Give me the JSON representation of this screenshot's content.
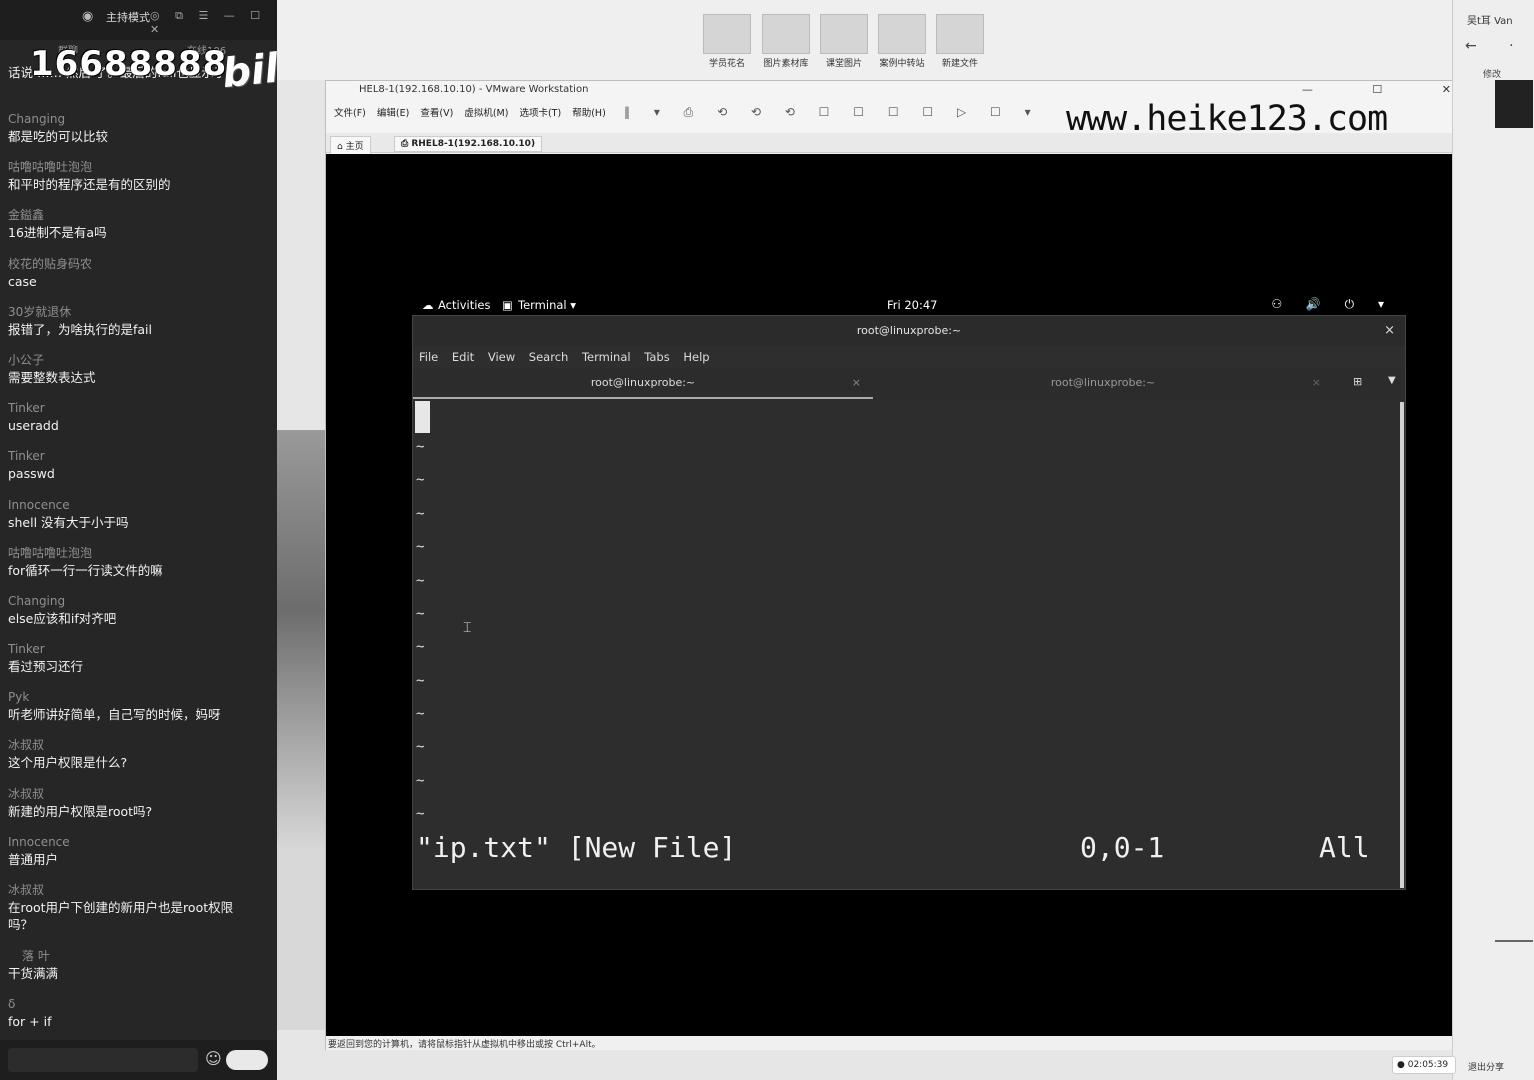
{
  "chat": {
    "mode_label": "主持模式",
    "top_icons": "◎ ⧉ ☰ — ☐ ✕",
    "sub_left": "群聊",
    "sub_right": "在线106",
    "overlay_number": "16688888",
    "overlay_logo": "bilibili",
    "first_message": "话说 …… 然后 了。最后的fail也显示了",
    "messages": [
      {
        "user": "Changing",
        "text": "都是吃的可以比较"
      },
      {
        "user": "咕噜咕噜吐泡泡",
        "text": "和平时的程序还是有的区别的"
      },
      {
        "user": "金鎰鑫",
        "text": "16进制不是有a吗"
      },
      {
        "user": "校花的贴身码农",
        "text": "case"
      },
      {
        "user": "30岁就退休",
        "text": "报错了，为啥执行的是fail"
      },
      {
        "user": "小公子",
        "text": "需要整数表达式"
      },
      {
        "user": "Tinker",
        "text": "useradd"
      },
      {
        "user": "Tinker",
        "text": "passwd"
      },
      {
        "user": "Innocence",
        "text": "shell 没有大于小于吗"
      },
      {
        "user": "咕噜咕噜吐泡泡",
        "text": "for循环一行一行读文件的嘛"
      },
      {
        "user": "Changing",
        "text": "else应该和if对齐吧"
      },
      {
        "user": "Tinker",
        "text": "看过预习还行"
      },
      {
        "user": "Pyk",
        "text": "听老师讲好简单，自己写的时候，妈呀"
      },
      {
        "user": "冰叔叔",
        "text": "这个用户权限是什么?"
      },
      {
        "user": "冰叔叔",
        "text": "新建的用户权限是root吗?"
      },
      {
        "user": "Innocence",
        "text": "普通用户"
      },
      {
        "user": "冰叔叔",
        "text": "在root用户下创建的新用户也是root权限吗？"
      },
      {
        "user": "落 叶",
        "text": "干货满满"
      },
      {
        "user": "δ",
        "text": "for + if"
      }
    ]
  },
  "shelf": [
    "学员花名",
    "图片素材库",
    "课堂图片",
    "案例中转站",
    "新建文件"
  ],
  "vmware": {
    "title": "HEL8-1(192.168.10.10) - VMware Workstation",
    "window_controls": "— ☐ ✕",
    "menu": [
      "文件(F)",
      "编辑(E)",
      "查看(V)",
      "虚拟机(M)",
      "选项卡(T)",
      "帮助(H)"
    ],
    "toolbar_icons": "‖ ▾ ⎙ ⟲ ⟲ ⟲ ☐ ☐ ☐ ☐ ▷ ☐ ▾",
    "watermark": "www.heike123.com",
    "tab_home": "主页",
    "tab_vm": "RHEL8-1(192.168.10.10)",
    "status_text": "要返回到您的计算机，请将鼠标指针从虚拟机中移出或按 Ctrl+Alt。"
  },
  "gnome": {
    "activities": "Activities",
    "app_menu": "Terminal ▾",
    "clock": "Fri 20:47",
    "tray": "⚇ 🔊 ⏻ ▾"
  },
  "terminal": {
    "title": "root@linuxprobe:~",
    "close": "×",
    "menu": [
      "File",
      "Edit",
      "View",
      "Search",
      "Terminal",
      "Tabs",
      "Help"
    ],
    "tab1": "root@linuxprobe:~",
    "tab2": "root@linuxprobe:~",
    "tab_close": "×",
    "tilde": "~",
    "vim_file": "\"ip.txt\" [New File]",
    "vim_pos": "0,0-1",
    "vim_all": "All"
  },
  "right_panel": {
    "user": "吴t耳 Van",
    "nav": "← ·",
    "edit": "修改"
  },
  "bottom": {
    "timer": "● 02:05:39",
    "exit_share": "退出分享"
  },
  "colors": {
    "chat_bg": "#262626",
    "terminal_bg": "#2d2d2d",
    "vm_screen": "#000000"
  }
}
